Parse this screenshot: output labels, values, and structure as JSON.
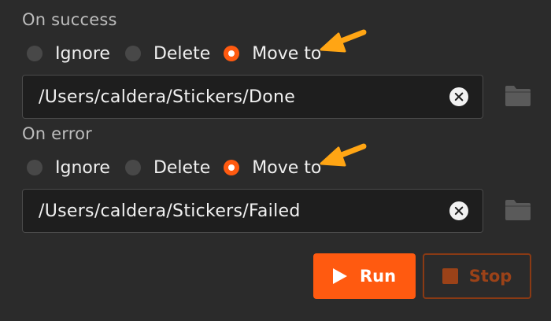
{
  "on_success": {
    "label": "On success",
    "options": [
      "Ignore",
      "Delete",
      "Move to"
    ],
    "selected": "Move to",
    "path": "/Users/caldera/Stickers/Done"
  },
  "on_error": {
    "label": "On error",
    "options": [
      "Ignore",
      "Delete",
      "Move to"
    ],
    "selected": "Move to",
    "path": "/Users/caldera/Stickers/Failed"
  },
  "buttons": {
    "run_label": "Run",
    "stop_label": "Stop"
  },
  "colors": {
    "background": "#2b2b2b",
    "accent": "#ff5a10",
    "annotation_arrow": "#ffa514",
    "stop_disabled": "#9b4218",
    "field_background": "#1e1e1e"
  },
  "icons": {
    "clear": "clear-icon",
    "folder": "folder-icon",
    "play": "play-icon",
    "stop": "stop-icon",
    "annotation": "arrow-annotation-icon"
  }
}
